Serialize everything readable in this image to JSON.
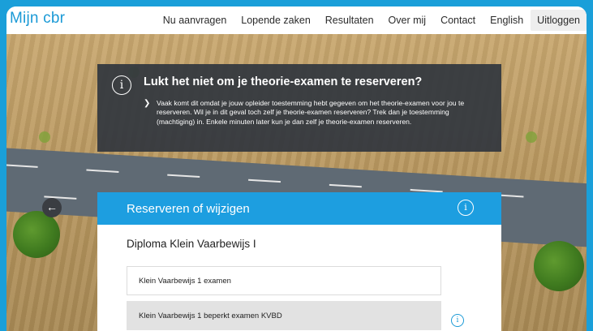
{
  "header": {
    "logo": "Mijn cbr",
    "nav": [
      "Nu aanvragen",
      "Lopende zaken",
      "Resultaten",
      "Over mij",
      "Contact",
      "English"
    ],
    "logout": "Uitloggen"
  },
  "info": {
    "icon": "info-icon",
    "title": "Lukt het niet om je theorie-examen te reserveren?",
    "text": "Vaak komt dit omdat je jouw opleider toestemming hebt gegeven om het theorie-examen voor jou te reserveren. Wil je in dit geval toch zelf je theorie-examen reserveren? Trek dan je toestemming (machtiging) in. Enkele minuten later kun je dan zelf je theorie-examen reserveren."
  },
  "card": {
    "title": "Reserveren of wijzigen",
    "subtitle": "Diploma Klein Vaarbewijs I",
    "options": [
      {
        "label": "Klein Vaarbewijs 1 examen",
        "disabled": false
      },
      {
        "label": "Klein Vaarbewijs 1 beperkt examen KVBD",
        "disabled": true
      }
    ]
  },
  "colors": {
    "accent": "#1d9ee0",
    "info_bg": "#32373e",
    "page_border": "#1a9fd9"
  }
}
